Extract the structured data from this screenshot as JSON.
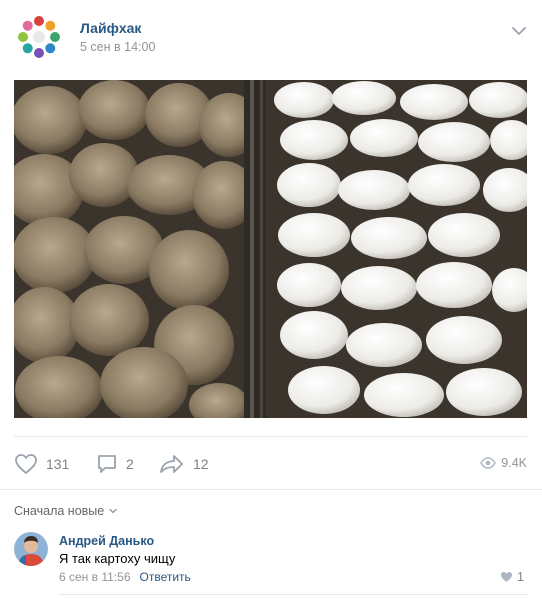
{
  "post": {
    "group_name": "Лайфхак",
    "date": "5 сен в 14:00",
    "avatar_icon": "group-logo-icon",
    "photo_description_icon": "sheep-photo"
  },
  "actions": {
    "likes": "131",
    "comments": "2",
    "shares": "12",
    "views": "9.4K"
  },
  "comments_section": {
    "sort_label": "Сначала новые",
    "items": [
      {
        "author": "Андрей Данько",
        "text": "Я так картоху чищу",
        "date": "6 сен в 11:56",
        "reply_label": "Ответить",
        "likes": "1"
      }
    ]
  },
  "colors": {
    "link": "#2a5885",
    "muted": "#939393",
    "border": "#e7e8ec"
  }
}
